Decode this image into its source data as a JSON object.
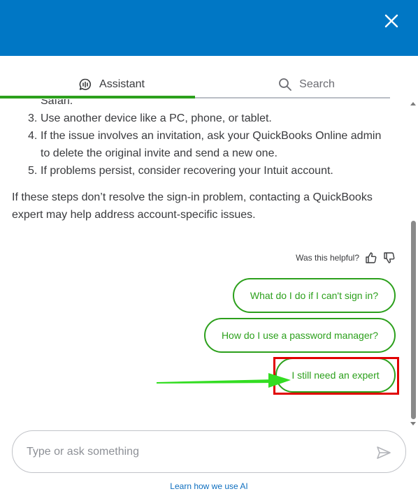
{
  "header": {
    "close_label": "close"
  },
  "tabs": [
    {
      "label": "Assistant",
      "active": true
    },
    {
      "label": "Search",
      "active": false
    }
  ],
  "chat": {
    "prev_line": "Safari.",
    "steps": [
      {
        "num": "3.",
        "text": "Use another device like a PC, phone, or tablet."
      },
      {
        "num": "4.",
        "text": "If the issue involves an invitation, ask your QuickBooks Online admin to delete the original invite and send a new one."
      },
      {
        "num": "5.",
        "text": "If problems persist, consider recovering your Intuit account."
      }
    ],
    "answer": "If these steps don’t resolve the sign-in problem, contacting a QuickBooks expert may help address account-specific issues.",
    "feedback_label": "Was this helpful?"
  },
  "suggestions": [
    "What do I do if I can't sign in?",
    "How do I use a password manager?",
    "I still need an expert"
  ],
  "input": {
    "placeholder": "Type or ask something"
  },
  "footer": {
    "learn_link": "Learn how we use AI"
  },
  "colors": {
    "header": "#0077c5",
    "accent_green": "#2ca01c",
    "highlight": "#e00000",
    "arrow": "#33dd22",
    "link": "#0d6ebf"
  }
}
